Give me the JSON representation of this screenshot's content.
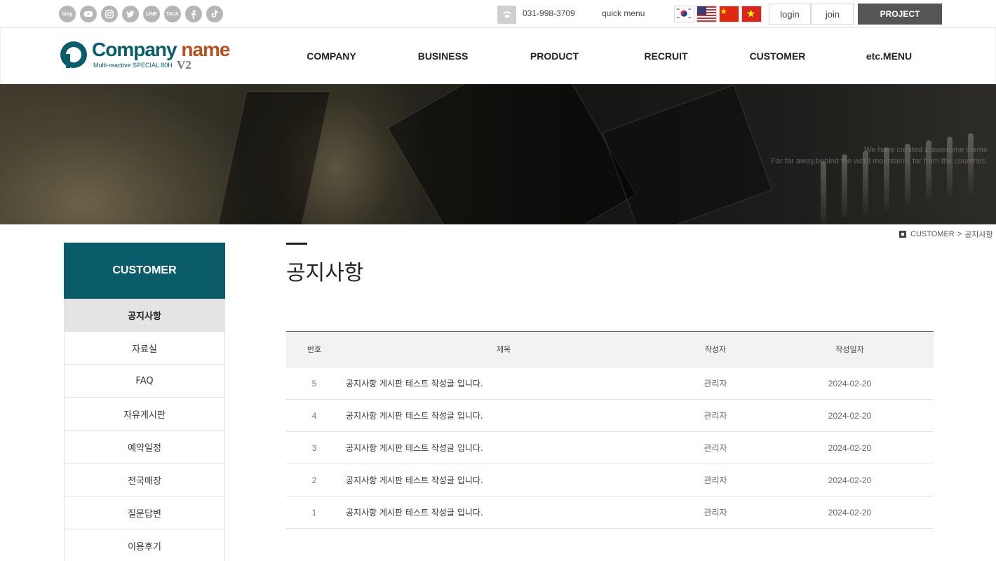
{
  "topbar": {
    "social": [
      {
        "name": "blog-icon",
        "label": "blog"
      },
      {
        "name": "youtube-icon",
        "label": ""
      },
      {
        "name": "instagram-icon",
        "label": ""
      },
      {
        "name": "twitter-icon",
        "label": ""
      },
      {
        "name": "line-icon",
        "label": "LINE"
      },
      {
        "name": "kakaotalk-icon",
        "label": "TALK"
      },
      {
        "name": "facebook-icon",
        "label": ""
      },
      {
        "name": "tiktok-icon",
        "label": ""
      }
    ],
    "phone": "031-998-3709",
    "quick_menu": "quick menu",
    "login": "login",
    "join": "join",
    "project": "PROJECT"
  },
  "logo": {
    "title_part1": "Company",
    "title_part2": "name",
    "subtitle": "Multi-reactive SPECIAL 80H",
    "version": "V2"
  },
  "nav": [
    "COMPANY",
    "BUSINESS",
    "PRODUCT",
    "RECRUIT",
    "CUSTOMER",
    "etc.MENU"
  ],
  "banner": {
    "line1": "We have created a awesome theme",
    "line2": "Far far away,behind the word mountains, far from the countries."
  },
  "breadcrumb": {
    "section": "CUSTOMER",
    "separator": ">",
    "page": "공지사항"
  },
  "sidebar": {
    "title": "CUSTOMER",
    "items": [
      "공지사항",
      "자료실",
      "FAQ",
      "자유게시판",
      "예약일정",
      "전국매장",
      "질문답변",
      "이용후기"
    ]
  },
  "content": {
    "title": "공지사항"
  },
  "board": {
    "headers": {
      "no": "번호",
      "title": "제목",
      "writer": "작성자",
      "date": "작성일자"
    },
    "rows": [
      {
        "no": "5",
        "title": "공지사항 게시판 테스트 작성글 입니다.",
        "writer": "관리자",
        "date": "2024-02-20"
      },
      {
        "no": "4",
        "title": "공지사항 게시판 테스트 작성글 입니다.",
        "writer": "관리자",
        "date": "2024-02-20"
      },
      {
        "no": "3",
        "title": "공지사항 게시판 테스트 작성글 입니다.",
        "writer": "관리자",
        "date": "2024-02-20"
      },
      {
        "no": "2",
        "title": "공지사항 게시판 테스트 작성글 입니다.",
        "writer": "관리자",
        "date": "2024-02-20"
      },
      {
        "no": "1",
        "title": "공지사항 게시판 테스트 작성글 입니다.",
        "writer": "관리자",
        "date": "2024-02-20"
      }
    ]
  },
  "colors": {
    "brand_teal": "#0b5c6b",
    "brand_orange": "#b35322",
    "project_button": "#555555",
    "active_side_item": "#e4e4e4"
  }
}
